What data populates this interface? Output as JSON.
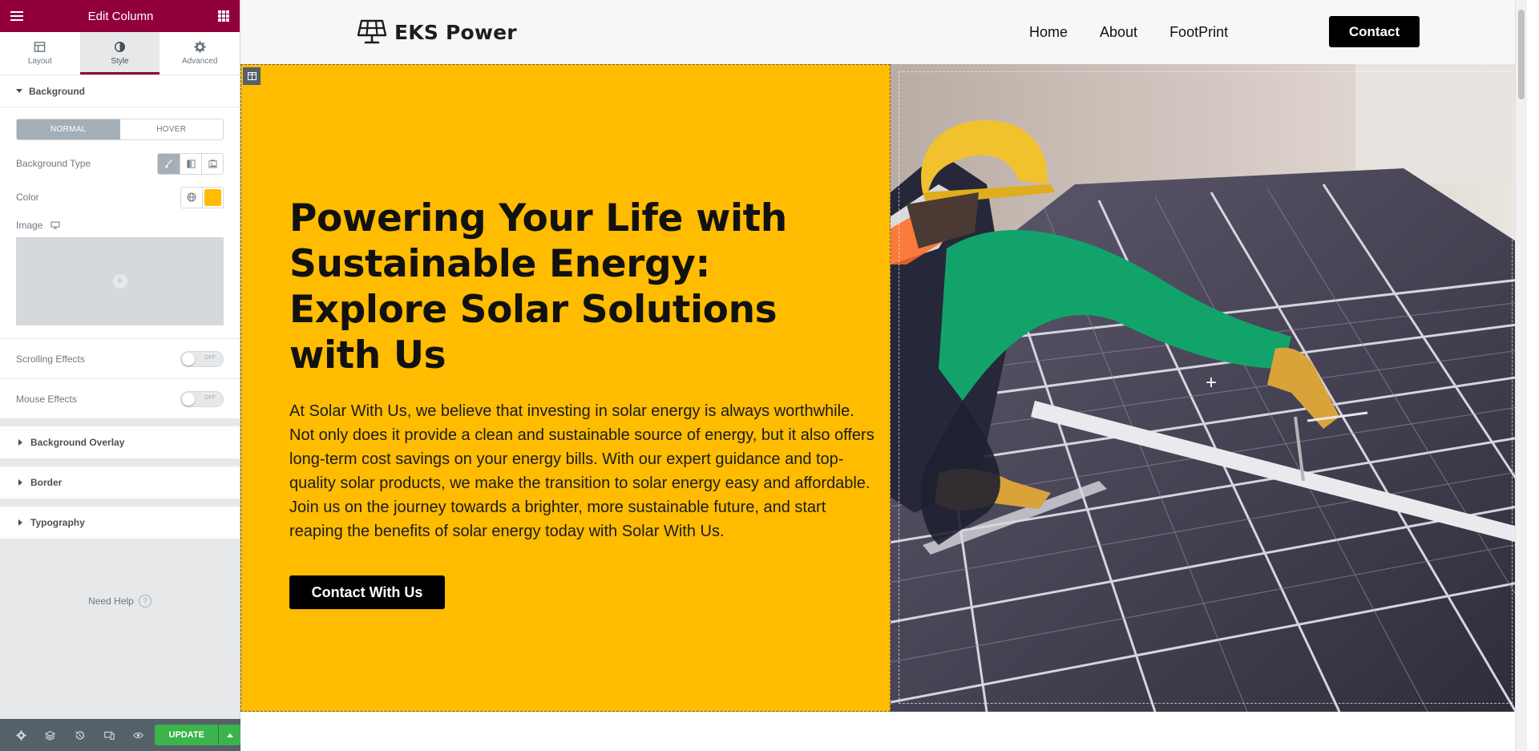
{
  "panel": {
    "title": "Edit Column",
    "tabs": [
      {
        "label": "Layout",
        "icon": "layout-icon"
      },
      {
        "label": "Style",
        "icon": "style-icon"
      },
      {
        "label": "Advanced",
        "icon": "gear-icon"
      }
    ],
    "active_tab": "Style",
    "background_section": "Background",
    "state_normal": "NORMAL",
    "state_hover": "HOVER",
    "background_type_label": "Background Type",
    "background_types": [
      "classic-brush-icon",
      "gradient-icon",
      "slideshow-icon"
    ],
    "color_label": "Color",
    "color_value": "#FFBC01",
    "image_label": "Image",
    "scrolling_effects_label": "Scrolling Effects",
    "mouse_effects_label": "Mouse Effects",
    "switch_off": "OFF",
    "sections": [
      "Background Overlay",
      "Border",
      "Typography"
    ],
    "need_help": "Need Help",
    "update_label": "UPDATE"
  },
  "site": {
    "logo_text": "EKS Power",
    "nav": [
      "Home",
      "About",
      "FootPrint"
    ],
    "contact_button": "Contact",
    "hero": {
      "title": "Powering Your Life with Sustainable Energy: Explore Solar Solutions with Us",
      "text": "At Solar With Us, we believe that investing in solar energy is always worthwhile. Not only does it provide a clean and sustainable source of energy, but it also offers long-term cost savings on your energy bills. With our expert guidance and top-quality solar products, we make the transition to solar energy easy and affordable. Join us on the journey towards a brighter, more sustainable future, and start reaping the benefits of solar energy today with Solar With Us.",
      "button": "Contact With Us",
      "background_color": "#FFBC01"
    }
  }
}
